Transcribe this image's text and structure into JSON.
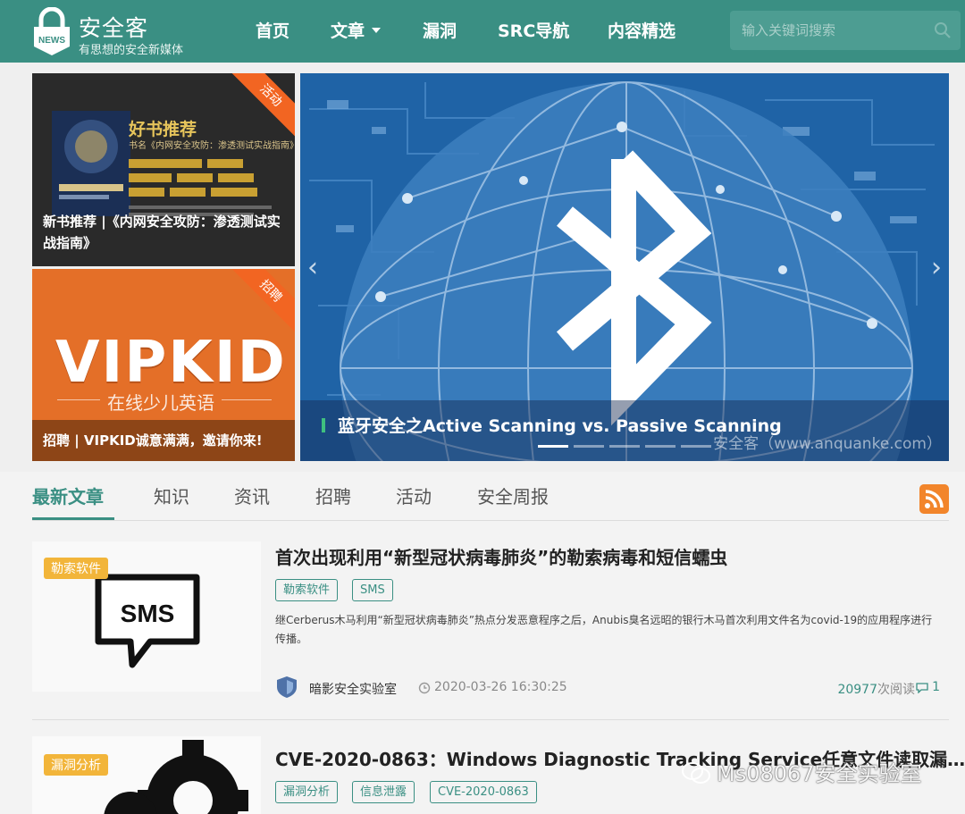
{
  "header": {
    "logo_badge": "NEWS",
    "logo_title": "安全客",
    "logo_slogan": "有思想的安全新媒体",
    "nav": [
      {
        "label": "首页"
      },
      {
        "label": "文章",
        "has_dropdown": true
      },
      {
        "label": "漏洞"
      },
      {
        "label": "SRC导航"
      },
      {
        "label": "内容精选"
      }
    ],
    "search_placeholder": "输入关键词搜索",
    "search_icon": "search-icon"
  },
  "promos": [
    {
      "corner": "活动",
      "book_heading": "好书推荐",
      "book_subtitle": "书名《内网安全攻防：渗透测试实战指南》",
      "caption": "新书推荐 |《内网安全攻防：渗透测试实战指南》"
    },
    {
      "corner": "招聘",
      "brand": "VIPKID",
      "brand_tagline": "在线少儿英语",
      "caption": "招聘 | VIPKID诚意满满，邀请你来!"
    }
  ],
  "hero": {
    "title": "蓝牙安全之Active Scanning vs. Passive Scanning",
    "watermark": "安全客（www.anquanke.com）",
    "slide_count": 5,
    "active_slide": 0
  },
  "tabs": [
    {
      "label": "最新文章",
      "active": true
    },
    {
      "label": "知识"
    },
    {
      "label": "资讯"
    },
    {
      "label": "招聘"
    },
    {
      "label": "活动"
    },
    {
      "label": "安全周报"
    }
  ],
  "articles": [
    {
      "category": "勒索软件",
      "thumb_text": "SMS",
      "title": "首次出现利用“新型冠状病毒肺炎”的勒索病毒和短信蠕虫",
      "tags": [
        "勒索软件",
        "SMS"
      ],
      "summary": "继Cerberus木马利用“新型冠状病毒肺炎”热点分发恶意程序之后，Anubis臭名远昭的银行木马首次利用文件名为covid-19的应用程序进行传播。",
      "author": "暗影安全实验室",
      "date": "2020-03-26 16:30:25",
      "reads": "20977",
      "reads_suffix": "次阅读",
      "comments": "1"
    },
    {
      "category": "漏洞分析",
      "title": "CVE-2020-0863：Windows Diagnostic Tracking Service任意文件读取漏…",
      "tags": [
        "漏洞分析",
        "信息泄露",
        "CVE-2020-0863"
      ]
    }
  ],
  "overlay_watermark": "Ms08067安全实验室",
  "colors": {
    "brand": "#3a8f83",
    "badge": "#f2b53a",
    "corner": "#f26522",
    "rss": "#f2852b"
  }
}
